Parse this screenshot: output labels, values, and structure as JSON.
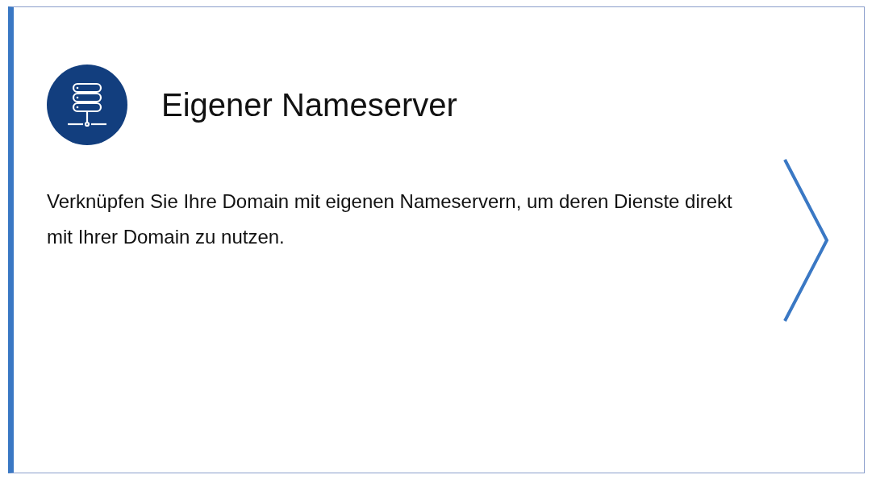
{
  "card": {
    "title": "Eigener Nameserver",
    "description": "Verknüpfen Sie Ihre Domain mit eigenen Nameservern, um deren Dienste direkt mit Ihrer Domain zu nutzen."
  }
}
